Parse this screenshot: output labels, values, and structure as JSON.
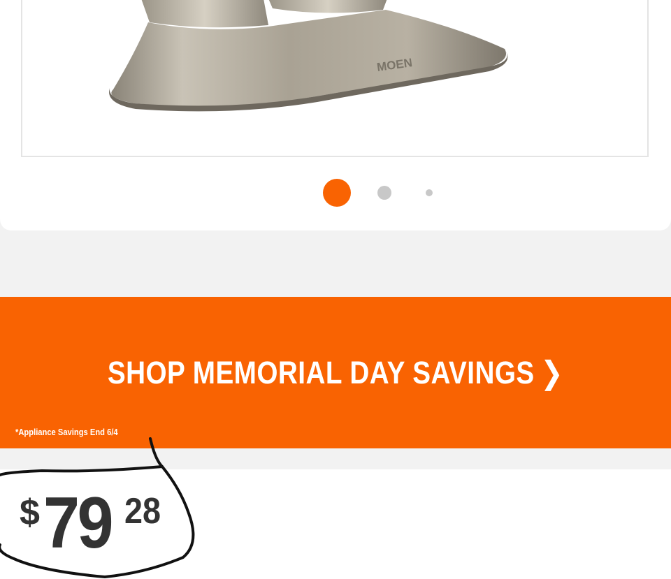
{
  "gallery": {
    "brand_mark": "MOEN",
    "active_index": 1,
    "total": 3
  },
  "promo": {
    "cta_label": "SHOP MEMORIAL DAY SAVINGS",
    "chevron": "❯",
    "disclaimer": "*Appliance Savings End 6/4",
    "color": "#f96302"
  },
  "price": {
    "currency": "$",
    "dollars": "79",
    "cents": "28"
  },
  "colors": {
    "accent": "#f96302",
    "text": "#333333",
    "inactive_dot": "#c8c8c8"
  }
}
